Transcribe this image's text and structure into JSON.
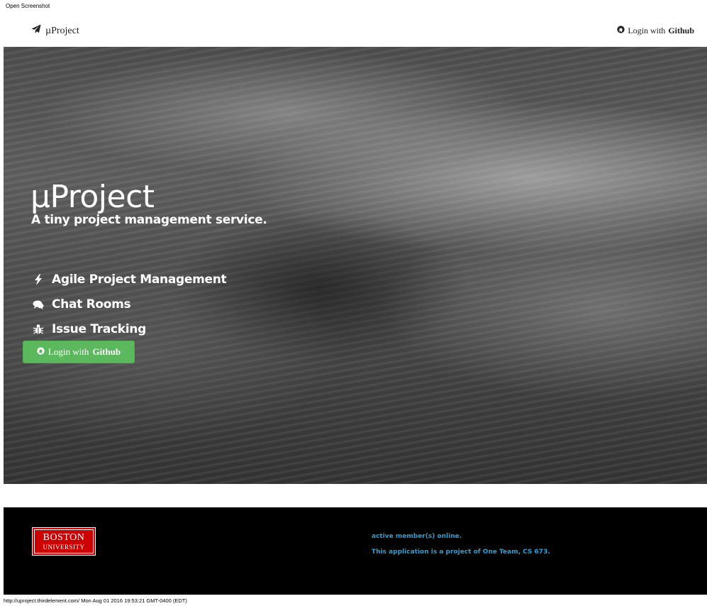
{
  "window": {
    "caption": "Open Screenshot"
  },
  "navbar": {
    "brand": "µProject",
    "brand_icon": "paper-plane-icon",
    "login_prefix": "Login with",
    "login_bold": "Github",
    "login_icon": "github-icon"
  },
  "hero": {
    "title": "µProject",
    "subtitle": "A tiny project management service.",
    "features": [
      {
        "label": "Agile Project Management",
        "icon": "bolt-icon"
      },
      {
        "label": "Chat Rooms",
        "icon": "comments-icon"
      },
      {
        "label": "Issue Tracking",
        "icon": "bug-icon"
      }
    ],
    "button_prefix": "Login with",
    "button_bold": "Github",
    "button_color": "#5cb85c"
  },
  "footer": {
    "logo_line1": "BOSTON",
    "logo_line2": "UNIVERSITY",
    "logo_color": "#cc0000",
    "online_text": "active member(s) online.",
    "project_text": "This application is a project of One Team, CS 673.",
    "text_color": "#2a9fd6"
  },
  "status_bar": {
    "text": "http://uproject.thirdelement.com/ Mon Aug 01 2016 19:53:21 GMT-0400 (EDT)"
  }
}
